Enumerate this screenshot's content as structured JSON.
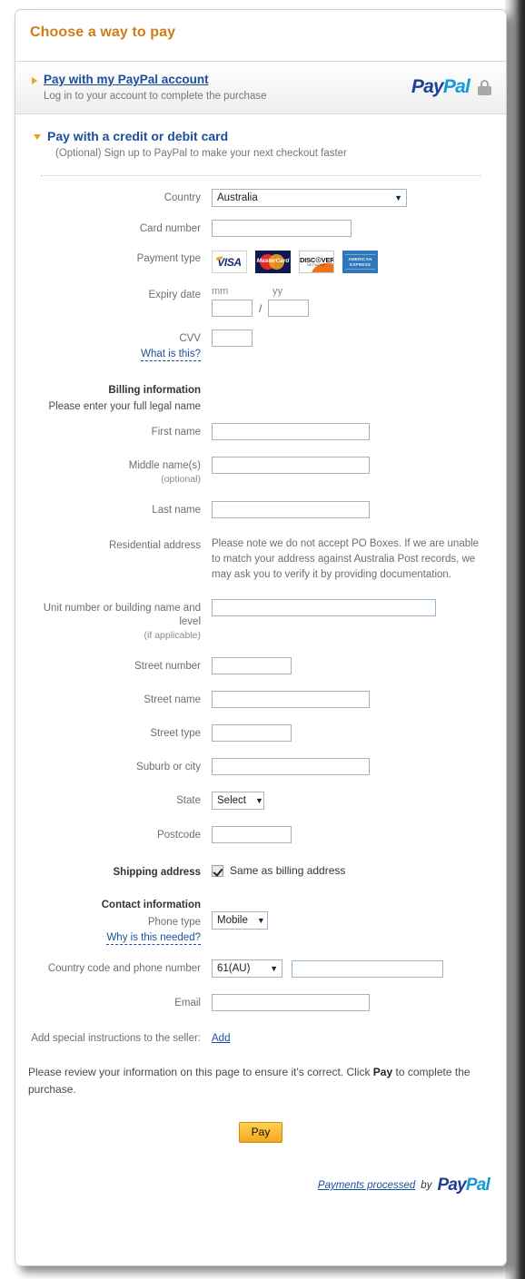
{
  "page": {
    "title": "Choose a way to pay"
  },
  "paypal_account": {
    "link_label": "Pay with my PayPal account",
    "sub_label": "Log in to your account to complete the purchase",
    "logo_part1": "Pay",
    "logo_part2": "Pal",
    "lock_icon": "lock-icon",
    "arrow_icon": "triangle-right-icon"
  },
  "card_section": {
    "title": "Pay with a credit or debit card",
    "sub_label": "(Optional) Sign up to PayPal to make your next checkout faster",
    "arrow_icon": "triangle-down-icon"
  },
  "fields": {
    "country": {
      "label": "Country",
      "value": "Australia",
      "caret": "▼"
    },
    "card_number": {
      "label": "Card number",
      "value": "",
      "placeholder": ""
    },
    "payment_type": {
      "label": "Payment type",
      "brands": [
        {
          "name": "visa",
          "text": "VISA"
        },
        {
          "name": "mastercard",
          "text": "MasterCard"
        },
        {
          "name": "discover",
          "text": "DISC☉VER",
          "sub": "NETWORK"
        },
        {
          "name": "amex",
          "line1": "AMERICAN",
          "line2": "EXPRESS"
        }
      ]
    },
    "expiry": {
      "label": "Expiry date",
      "mm_header": "mm",
      "yy_header": "yy",
      "mm_value": "",
      "yy_value": "",
      "separator": "/"
    },
    "cvv": {
      "label": "CVV",
      "value": "",
      "help_link": "What is this?"
    },
    "billing_heading": "Billing information",
    "billing_note": "Please enter your full legal name",
    "first_name": {
      "label": "First name",
      "value": ""
    },
    "middle_name": {
      "label": "Middle name(s)",
      "sub": "(optional)",
      "value": ""
    },
    "last_name": {
      "label": "Last name",
      "value": ""
    },
    "residential_address": {
      "label": "Residential address",
      "note": "Please note we do not accept PO Boxes. If we are unable to match your address against Australia Post records, we may ask you to verify it by providing documentation."
    },
    "unit_number": {
      "label": "Unit number or building name and level",
      "sub": "(if applicable)",
      "value": ""
    },
    "street_number": {
      "label": "Street number",
      "value": ""
    },
    "street_name": {
      "label": "Street name",
      "value": ""
    },
    "street_type": {
      "label": "Street type",
      "value": ""
    },
    "suburb": {
      "label": "Suburb or city",
      "value": ""
    },
    "state": {
      "label": "State",
      "value": "Select",
      "caret": "▼"
    },
    "postcode": {
      "label": "Postcode",
      "value": ""
    },
    "shipping_address": {
      "label": "Shipping address",
      "checkbox_label": "Same as billing address",
      "checked": true
    },
    "contact_heading": "Contact information",
    "phone_type": {
      "label": "Phone type",
      "value": "Mobile",
      "caret": "▼",
      "help_link": "Why is this needed?"
    },
    "country_code_phone": {
      "label": "Country code and phone number",
      "code_value": "61(AU)",
      "caret": "▼",
      "number_value": ""
    },
    "email": {
      "label": "Email",
      "value": ""
    },
    "special_instructions": {
      "label": "Add special instructions to the seller:",
      "link": "Add"
    }
  },
  "review": {
    "text_before": "Please review your information on this page to ensure it's correct. Click ",
    "bold": "Pay",
    "text_after": " to complete the purchase."
  },
  "pay_button": {
    "label": "Pay"
  },
  "footer": {
    "link": "Payments processed",
    "by": "by",
    "logo_part1": "Pay",
    "logo_part2": "Pal"
  },
  "colors": {
    "title_orange": "#d07c1a",
    "link_blue": "#1b4f9c",
    "paypal_dark": "#1c3f94",
    "paypal_light": "#139ad6",
    "pay_button": "#f5a623",
    "input_border": "#9eb4cb"
  }
}
